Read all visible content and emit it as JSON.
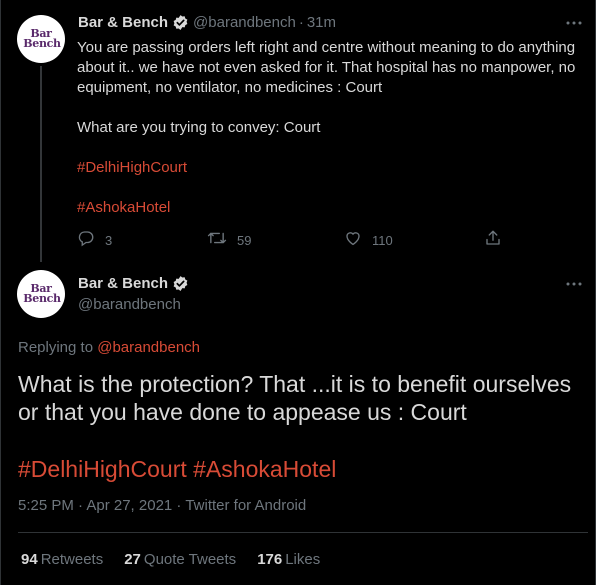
{
  "colors": {
    "background": "#000000",
    "accent": "#d84b36",
    "secondary_text": "#6e767d",
    "primary_text": "#d9d9d9"
  },
  "parent_tweet": {
    "avatar": {
      "line1": "Bar",
      "line2": "Bench",
      "icon": "bar-and-bench-logo"
    },
    "display_name": "Bar & Bench",
    "handle": "@barandbench",
    "separator": "·",
    "time": "31m",
    "paragraphs": [
      "You are passing orders left right and centre without meaning to do anything about it.. we have not even asked for it. That hospital has no manpower, no equipment, no ventilator, no medicines : Court",
      "What are you trying to convey: Court"
    ],
    "hashtags": [
      "#DelhiHighCourt",
      "#AshokaHotel"
    ],
    "actions": {
      "reply_count": "3",
      "retweet_count": "59",
      "like_count": "110"
    }
  },
  "main_tweet": {
    "avatar": {
      "line1": "Bar",
      "line2": "Bench",
      "icon": "bar-and-bench-logo"
    },
    "display_name": "Bar & Bench",
    "handle": "@barandbench",
    "replying_prefix": "Replying to",
    "replying_to": "@barandbench",
    "text": "What is the protection? That ...it is to benefit ourselves or that you have done to appease us : Court",
    "hashtags_line": "#DelhiHighCourt #AshokaHotel",
    "meta": "5:25 PM · Apr 27, 2021 · Twitter for Android",
    "stats": [
      {
        "num": "94",
        "label": "Retweets"
      },
      {
        "num": "27",
        "label": "Quote Tweets"
      },
      {
        "num": "176",
        "label": "Likes"
      }
    ]
  }
}
